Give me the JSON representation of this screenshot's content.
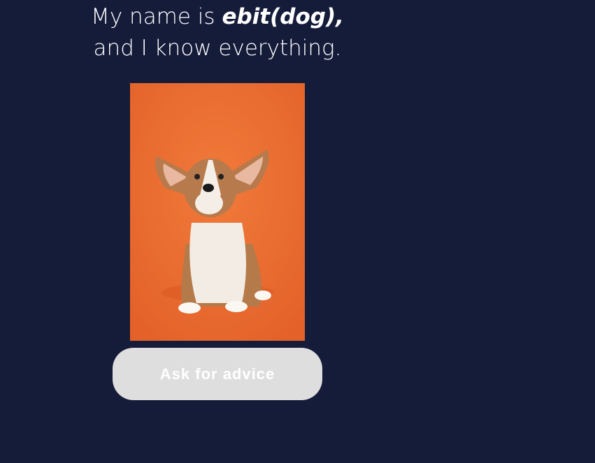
{
  "headline": {
    "prefix": "My name is ",
    "name": "ebit(dog),",
    "line2": "and I know everything."
  },
  "photo": {
    "subject": "corgi puppy on orange background",
    "background_color": "#ec6a2c"
  },
  "button": {
    "label": "Ask for advice"
  },
  "colors": {
    "page_background": "#151c3a",
    "button_background": "#dedede"
  }
}
